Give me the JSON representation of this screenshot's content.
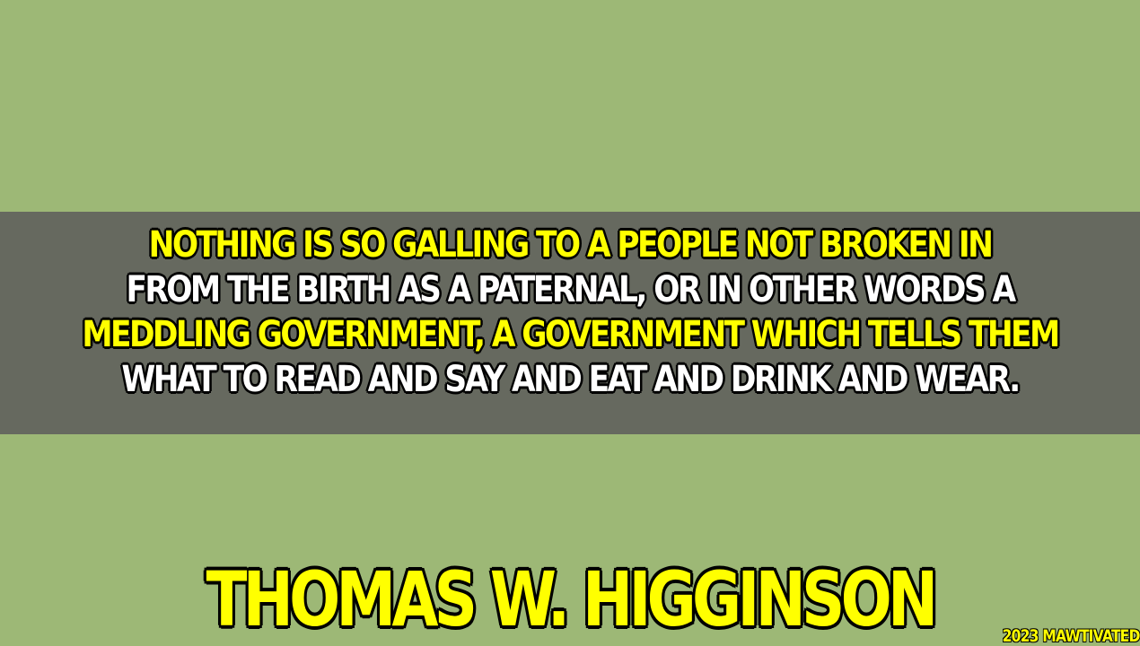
{
  "quote": {
    "lines": [
      "NOTHING IS SO GALLING TO A PEOPLE NOT BROKEN IN",
      "FROM THE BIRTH AS A PATERNAL, OR IN OTHER WORDS A",
      "MEDDLING GOVERNMENT, A GOVERNMENT WHICH TELLS THEM",
      "WHAT TO READ AND SAY AND EAT AND DRINK AND WEAR."
    ],
    "line_colors": [
      "#ffff00",
      "#ffffff",
      "#ffff00",
      "#ffffff"
    ]
  },
  "author": "THOMAS W. HIGGINSON",
  "watermark": "2023 MAWTIVATED",
  "colors": {
    "background": "#9db876",
    "band": "#66695f",
    "highlight": "#ffff00",
    "text": "#ffffff"
  }
}
